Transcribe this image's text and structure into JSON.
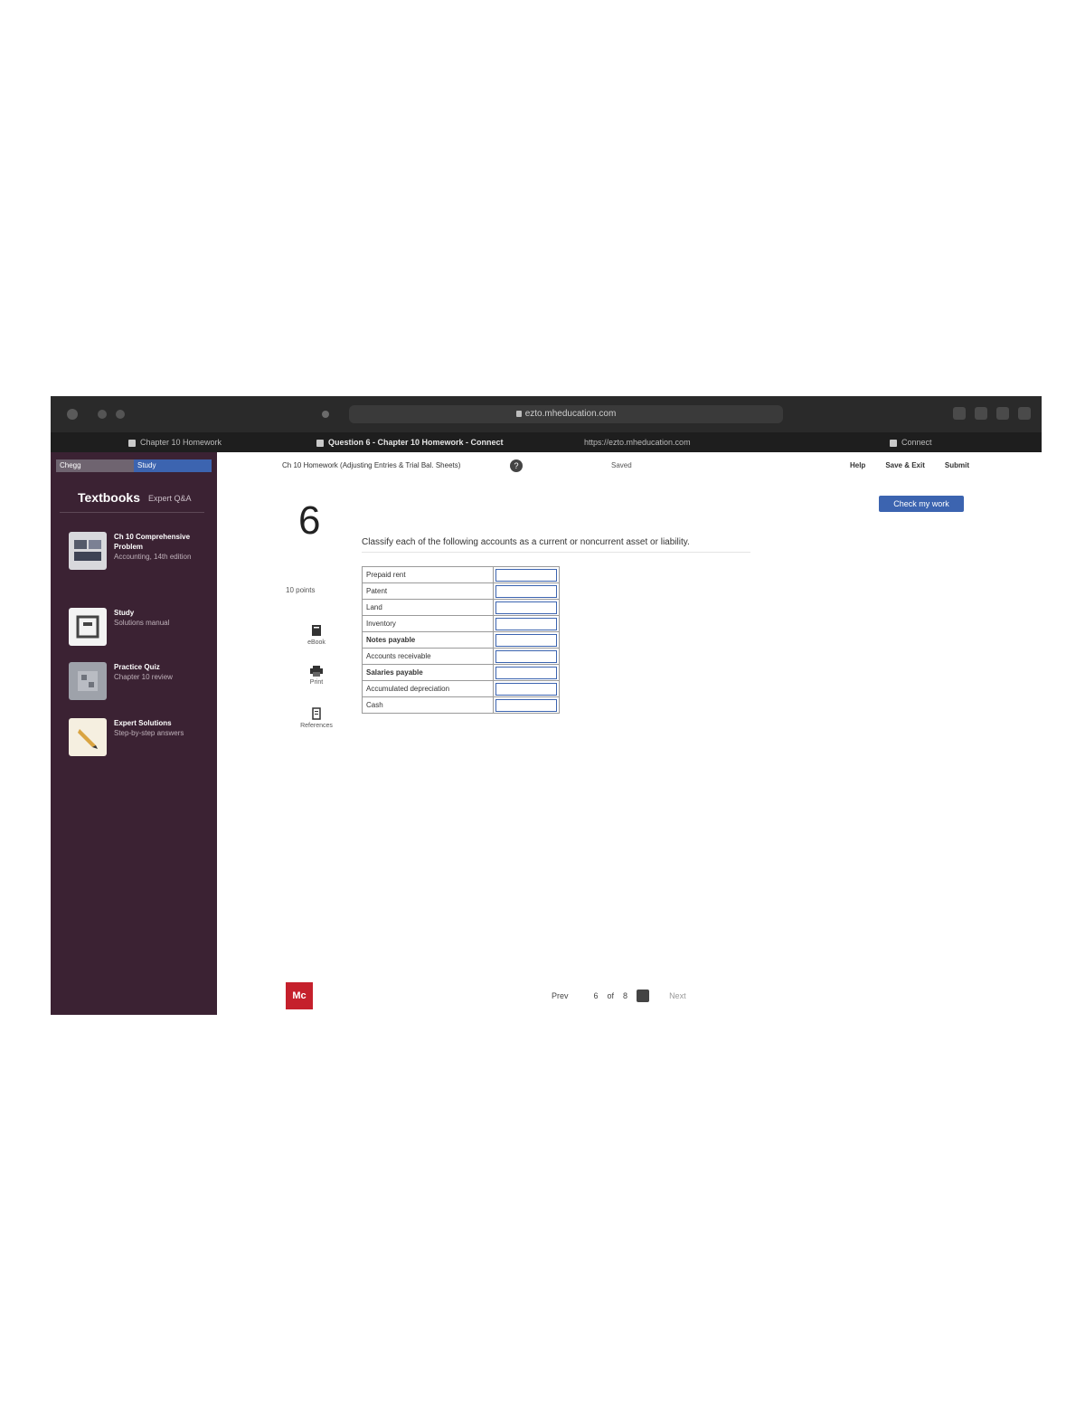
{
  "browser": {
    "url": "ezto.mheducation.com",
    "tabs": [
      {
        "label": "Chapter 10 Homework"
      },
      {
        "label": "Question 6 - Chapter 10 Homework - Connect"
      },
      {
        "label": "https://ezto.mheducation.com"
      },
      {
        "label": "Connect"
      }
    ]
  },
  "sidebar": {
    "top_tag_left": "Chegg",
    "top_tag_right": "Study",
    "title": "Textbooks",
    "subtitle": "Expert Q&A",
    "items": [
      {
        "title": "Ch 10 Comprehensive Problem",
        "meta": "Accounting, 14th edition"
      },
      {
        "title": "Study",
        "meta": "Solutions manual"
      },
      {
        "title": "Practice Quiz",
        "meta": "Chapter 10 review"
      },
      {
        "title": "Expert Solutions",
        "meta": "Step-by-step answers"
      }
    ]
  },
  "main": {
    "breadcrumb": "Ch 10 Homework (Adjusting Entries & Trial Bal. Sheets)",
    "help_icon": "?",
    "saved": "Saved",
    "links": [
      "Help",
      "Save & Exit",
      "Submit"
    ],
    "submit_button": "Check my work",
    "question_number": "6",
    "points": "10 points",
    "tools": [
      {
        "label": "eBook",
        "icon": "book-icon"
      },
      {
        "label": "Print",
        "icon": "print-icon"
      },
      {
        "label": "References",
        "icon": "reference-icon"
      }
    ],
    "prompt": "Classify each of the following accounts as a current or noncurrent asset or liability.",
    "accounts": [
      {
        "name": "Prepaid rent",
        "bold": false,
        "value": ""
      },
      {
        "name": "Patent",
        "bold": false,
        "value": ""
      },
      {
        "name": "Land",
        "bold": false,
        "value": ""
      },
      {
        "name": "Inventory",
        "bold": false,
        "value": ""
      },
      {
        "name": "Notes payable",
        "bold": true,
        "value": ""
      },
      {
        "name": "Accounts receivable",
        "bold": false,
        "value": ""
      },
      {
        "name": "Salaries payable",
        "bold": true,
        "value": ""
      },
      {
        "name": "Accumulated depreciation",
        "bold": false,
        "value": ""
      },
      {
        "name": "Cash",
        "bold": false,
        "value": ""
      }
    ]
  },
  "footer": {
    "logo_text": "Mc",
    "prev": "Prev",
    "page_current": "6",
    "page_total": "8",
    "page_of": "of",
    "next": "Next"
  },
  "colors": {
    "sidebar_bg": "#3b2233",
    "accent_blue": "#3c64b0",
    "logo_red": "#c5202c"
  }
}
